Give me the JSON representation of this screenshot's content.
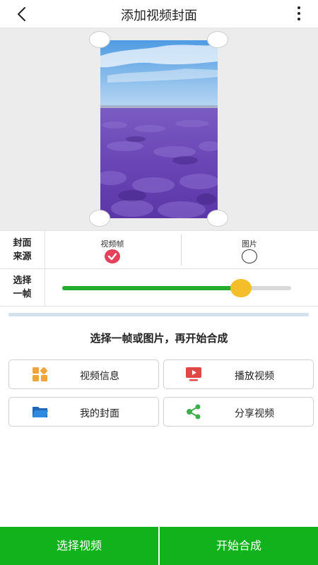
{
  "header": {
    "title": "添加视频封面",
    "back_icon": "chevron-left-icon",
    "menu_icon": "more-vertical-icon"
  },
  "cover_source": {
    "label": "封面来源",
    "options": [
      {
        "label": "视频帧",
        "selected": true
      },
      {
        "label": "图片",
        "selected": false
      }
    ]
  },
  "frame_select": {
    "label": "选择一帧",
    "progress": 0.78
  },
  "hint": "选择一帧或图片，再开始合成",
  "actions": [
    {
      "label": "视频信息",
      "icon": "grid-icon",
      "color": "#f0a43c"
    },
    {
      "label": "播放视频",
      "icon": "play-screen-icon",
      "color": "#e04848"
    },
    {
      "label": "我的封面",
      "icon": "folder-icon",
      "color": "#2f7fd6"
    },
    {
      "label": "分享视频",
      "icon": "share-icon",
      "color": "#3fae4d"
    }
  ],
  "bottom": {
    "select_video": "选择视频",
    "start_compose": "开始合成"
  },
  "colors": {
    "accent_green": "#12b21d",
    "slider_green": "#21ad2d",
    "slider_thumb": "#f4bd2a",
    "check_red": "#e5405c"
  }
}
